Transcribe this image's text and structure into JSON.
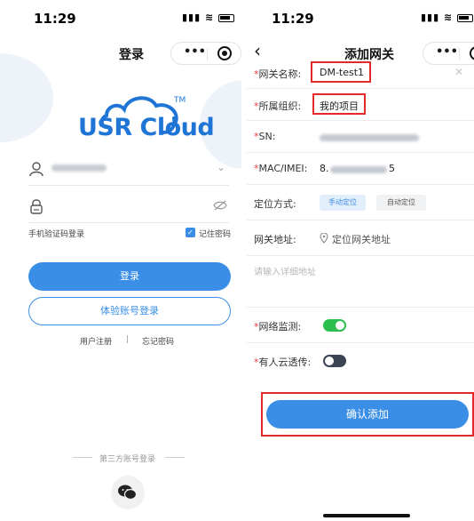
{
  "login": {
    "status_time": "11:29",
    "title": "登录",
    "logo_text": "USR Cloud",
    "logo_tm": "TM",
    "sms_login": "手机验证码登录",
    "remember_password": "记住密码",
    "login_button": "登录",
    "trial_button": "体验账号登录",
    "register": "用户注册",
    "divider": "|",
    "forgot_password": "忘记密码",
    "third_party": "第三方账号登录"
  },
  "add_gateway": {
    "status_time": "11:29",
    "title": "添加网关",
    "fields": {
      "name_label": "网关名称:",
      "name_value": "DM-test1",
      "org_label": "所属组织:",
      "org_value": "我的项目",
      "sn_label": "SN:",
      "mac_label": "MAC/IMEI:",
      "mac_prefix": "8.",
      "mac_suffix": "5",
      "location_label": "定位方式:",
      "location_manual": "手动定位",
      "location_auto": "自动定位",
      "address_label": "网关地址:",
      "address_locate": "定位网关地址",
      "address_detail_placeholder": "请输入详细地址",
      "network_monitor_label": "网络监测:",
      "transparent_label": "有人云透传:"
    },
    "required_mark": "*",
    "confirm_button": "确认添加",
    "toggles": {
      "network_monitor": true,
      "transparent": false
    }
  },
  "colors": {
    "primary": "#3a8ee6",
    "toggle_on": "#2dbe4f",
    "toggle_off": "#3b4452",
    "highlight": "#e22a2a",
    "required": "#e23b3b"
  },
  "icons": [
    "user-icon",
    "lock-icon",
    "eye-off-icon",
    "chevron-down-icon",
    "checkbox-icon",
    "wechat-icon",
    "pin-icon",
    "back-icon",
    "more-icon",
    "target-icon",
    "clear-icon"
  ]
}
